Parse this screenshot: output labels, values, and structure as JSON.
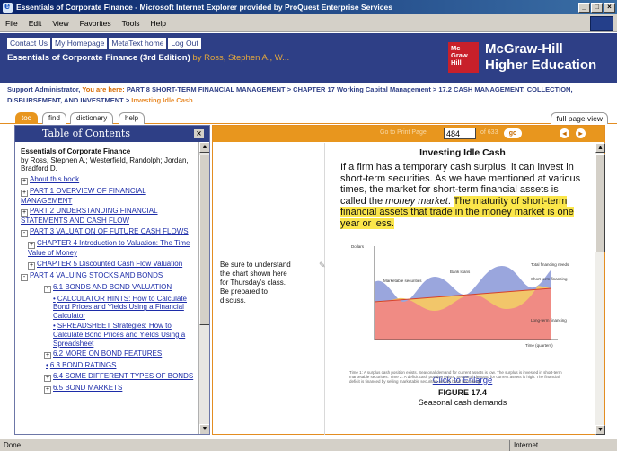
{
  "window": {
    "title": "Essentials of Corporate Finance - Microsoft Internet Explorer provided by ProQuest Enterprise Services",
    "minimize": "_",
    "maximize": "□",
    "close": "×"
  },
  "menu": [
    "File",
    "Edit",
    "View",
    "Favorites",
    "Tools",
    "Help"
  ],
  "header": {
    "links": [
      "Contact Us",
      "My Homepage",
      "MetaText home",
      "Log Out"
    ],
    "book_title": "Essentials of Corporate Finance (3rd Edition)",
    "book_authors": "by Ross, Stephen A., W...",
    "logo_text": "Mc Graw Hill",
    "publisher_line1": "McGraw-Hill",
    "publisher_line2": "Higher Education"
  },
  "breadcrumb": {
    "user": "Support Administrator,",
    "you_are_here": "You are here:",
    "path": "PART 8 SHORT-TERM FINANCIAL MANAGEMENT > CHAPTER 17 Working Capital Management > 17.2 CASH MANAGEMENT: COLLECTION, DISBURSEMENT, AND INVESTMENT >",
    "current": "Investing Idle Cash"
  },
  "tabs": [
    "toc",
    "find",
    "dictionary",
    "help"
  ],
  "full_page_view": "full page view",
  "toc": {
    "header": "Table of Contents",
    "book_title": "Essentials of Corporate Finance",
    "authors": "by Ross, Stephen A.; Westerfield, Randolph; Jordan, Bradford D.",
    "items": [
      {
        "marker": "+",
        "label": "About this book"
      },
      {
        "marker": "+",
        "label": "PART 1 OVERVIEW OF FINANCIAL MANAGEMENT"
      },
      {
        "marker": "+",
        "label": "PART 2 UNDERSTANDING FINANCIAL STATEMENTS AND CASH FLOW"
      },
      {
        "marker": "-",
        "label": "PART 3 VALUATION OF FUTURE CASH FLOWS"
      },
      {
        "marker": "+",
        "label": "CHAPTER 4 Introduction to Valuation: The Time Value of Money"
      },
      {
        "marker": "+",
        "label": "CHAPTER 5 Discounted Cash Flow Valuation"
      },
      {
        "marker": "-",
        "label": "PART 4 VALUING STOCKS AND BONDS"
      },
      {
        "marker": "-",
        "label": "6.1 BONDS AND BOND VALUATION"
      },
      {
        "marker": "•",
        "label": "CALCULATOR HINTS: How to Calculate Bond Prices and Yields Using a Financial Calculator"
      },
      {
        "marker": "•",
        "label": "SPREADSHEET Strategies: How to Calculate Bond Prices and Yields Using a Spreadsheet"
      },
      {
        "marker": "+",
        "label": "6.2 MORE ON BOND FEATURES"
      },
      {
        "marker": "•",
        "label": "6.3 BOND RATINGS"
      },
      {
        "marker": "+",
        "label": "6.4 SOME DIFFERENT TYPES OF BONDS"
      },
      {
        "marker": "+",
        "label": "6.5 BOND MARKETS"
      }
    ]
  },
  "pager": {
    "goto_label": "Go to Print Page",
    "page": "484",
    "of_pages": "of 633",
    "go": "go",
    "prev": "◂",
    "next": "▸"
  },
  "note": "Be sure to understand the chart shown here for Thursday's class. Be prepared to discuss.",
  "content": {
    "heading": "Investing Idle Cash",
    "para_part1": "If a firm has a temporary cash surplus, it can invest in short-term securities. As we have mentioned at various times, the market for short-term financial assets is called the ",
    "para_italic": "money market",
    "para_part2": ". ",
    "para_highlight": "The maturity of short-term financial assets that trade in the money market is one year or less.",
    "figure_caption": "Time 1: A surplus cash position exists. Seasonal demand for current assets is low. The surplus is invested in short-term marketable securities. Time 2: A deficit cash position exists. Seasonal demand for current assets is high. The financial deficit is financed by selling marketable securities and by bank borrowing.",
    "enlarge_link": "Click to Enlarge",
    "figure_number": "FIGURE 17.4",
    "figure_title": "Seasonal cash demands"
  },
  "figure": {
    "y_label": "Dollars",
    "x_label": "Time (quarters)",
    "labels": {
      "marketable": "Marketable securities",
      "bank_loans": "Bank loans",
      "total_financing": "Total financing needs",
      "short_term": "Short-term financing",
      "long_term": "Long-term financing"
    },
    "colors": {
      "marketable": "#9aa6dd",
      "bank_loans": "#f2c66a",
      "long_term": "#f08b84",
      "line_total": "#d6402a",
      "line_short": "#e07b25"
    }
  },
  "status": {
    "text": "Done",
    "zone": "Internet"
  }
}
